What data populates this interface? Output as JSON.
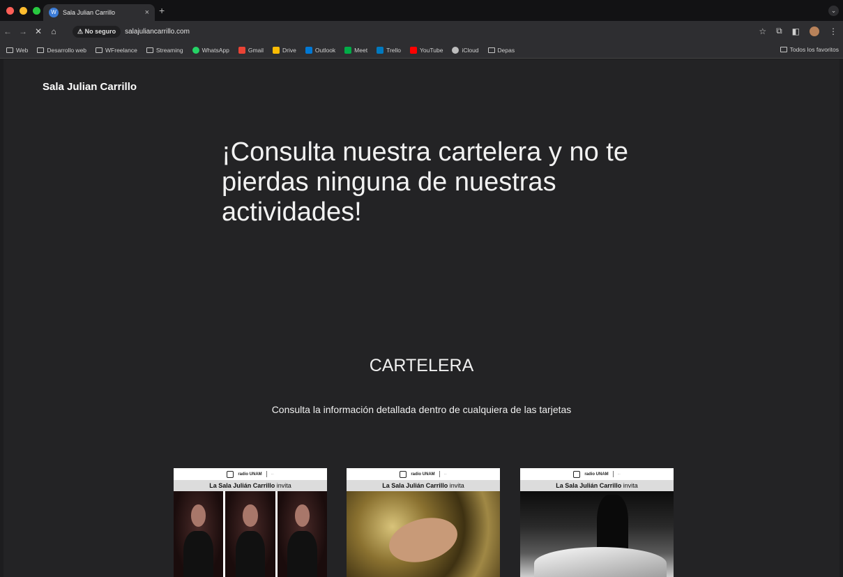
{
  "browser": {
    "tab_title": "Sala Julian Carrillo",
    "tab_favicon": "W",
    "security_label": "No seguro",
    "url": "salajuliancarrillo.com",
    "bookmarks": [
      "Web",
      "Desarrollo web",
      "WFreelance",
      "Streaming",
      "WhatsApp",
      "Gmail",
      "Drive",
      "Outlook",
      "Meet",
      "Trello",
      "YouTube",
      "iCloud",
      "Depas"
    ],
    "all_bookmarks": "Todos los favoritos"
  },
  "site": {
    "title": "Sala Julian Carrillo",
    "hero": "¡Consulta nuestra cartelera y no te pierdas ninguna de nuestras actividades!",
    "section_title": "CARTELERA",
    "section_subtitle": "Consulta la información detallada dentro de cualquiera de las tarjetas",
    "card_logo_text": "radio UNAM",
    "cards": [
      {
        "invite_bold": "La Sala Julián Carrillo",
        "invite_rest": " invita"
      },
      {
        "invite_bold": "La Sala Julián Carrillo",
        "invite_rest": " invita"
      },
      {
        "invite_bold": "La Sala Julián Carrillo",
        "invite_rest": " invita"
      }
    ]
  },
  "colors": {
    "page_bg": "#232325",
    "chrome_bg": "#2e2e31",
    "traffic_red": "#fe5f57",
    "traffic_yellow": "#febc2e",
    "traffic_green": "#28c840"
  }
}
